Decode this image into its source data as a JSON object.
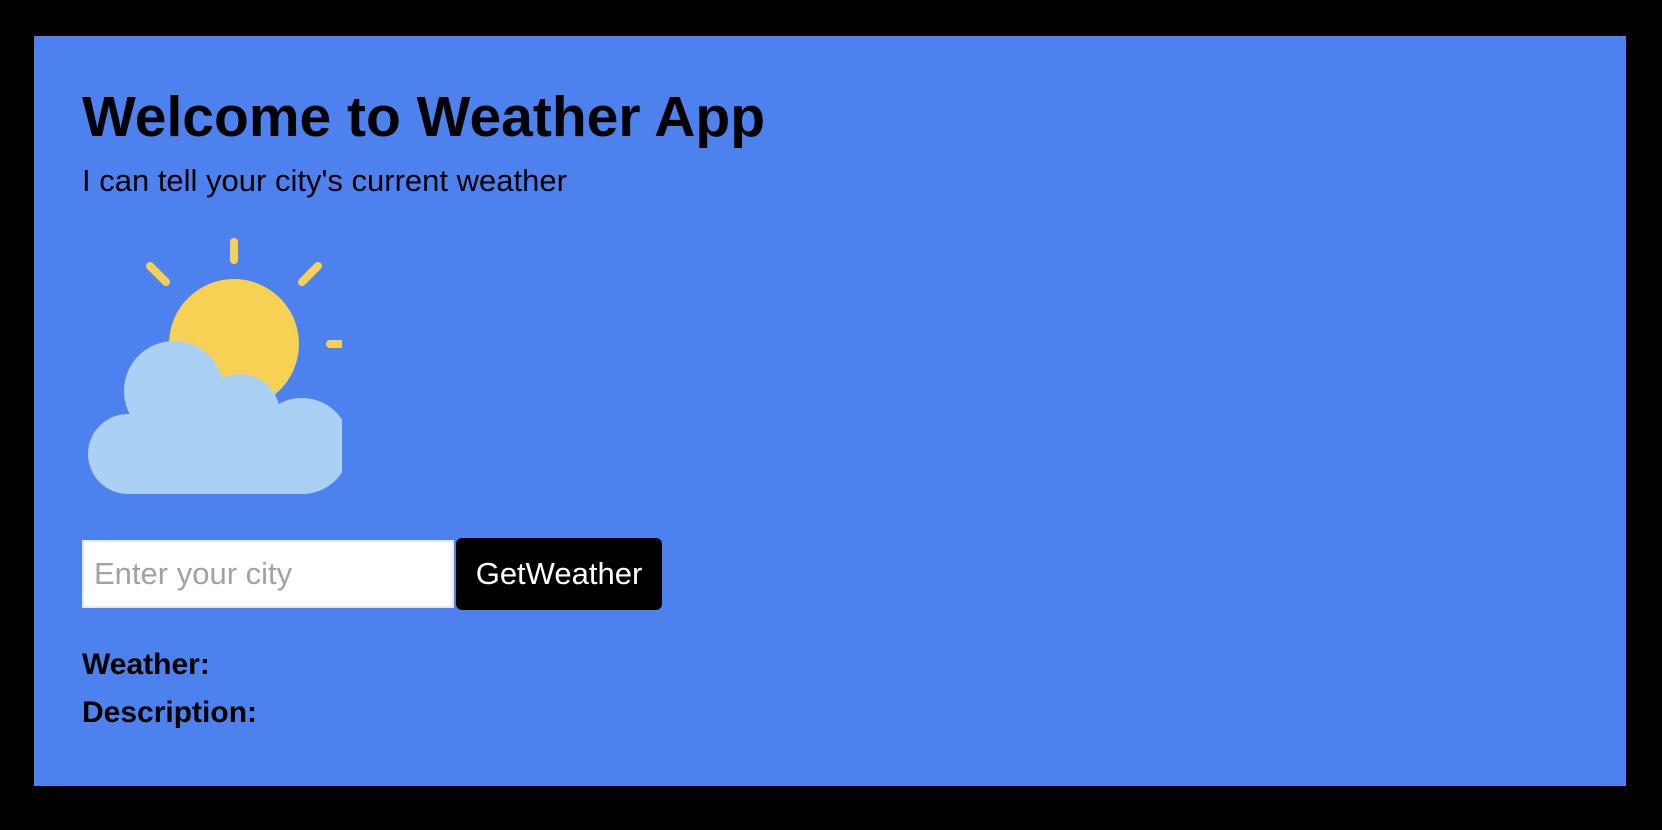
{
  "app": {
    "title": "Welcome to Weather App",
    "subtitle": "I can tell your city's current weather"
  },
  "icon": {
    "name": "partly-cloudy-icon",
    "sun_color": "#f7d154",
    "cloud_color": "#aad0f4"
  },
  "search": {
    "value": "",
    "placeholder": "Enter your city",
    "button_label": "GetWeather"
  },
  "result": {
    "weather_label": "Weather:",
    "weather_value": "",
    "description_label": "Description:",
    "description_value": ""
  },
  "colors": {
    "background": "#4d81ed",
    "frame": "#000000",
    "button": "#000000",
    "button_text": "#ffffff"
  }
}
